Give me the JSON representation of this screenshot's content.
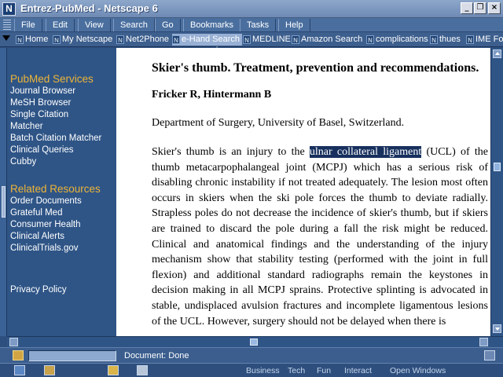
{
  "window": {
    "title": "Entrez-PubMed - Netscape 6",
    "logo_letter": "N",
    "minimize": "_",
    "restore": "❐",
    "close": "×"
  },
  "menu": [
    "File",
    "Edit",
    "View",
    "Search",
    "Go",
    "Bookmarks",
    "Tasks",
    "Help"
  ],
  "toolbar": {
    "items": [
      {
        "label": "Home"
      },
      {
        "label": "My Netscape"
      },
      {
        "label": "Net2Phone"
      },
      {
        "label": "e-Hand Search"
      },
      {
        "label": "MEDLINE"
      },
      {
        "label": "Amazon Search"
      },
      {
        "label": "complications"
      },
      {
        "label": "thues"
      },
      {
        "label": "IME Fo"
      }
    ]
  },
  "sidebar": {
    "services_heading": "PubMed Services",
    "services": [
      "Journal Browser",
      "MeSH Browser",
      "Single Citation",
      "Matcher",
      "Batch Citation Matcher",
      "Clinical Queries",
      "Cubby"
    ],
    "resources_heading": "Related Resources",
    "resources": [
      "Order Documents",
      "Grateful Med",
      "Consumer Health",
      "Clinical Alerts",
      "ClinicalTrials.gov"
    ],
    "privacy": "Privacy Policy"
  },
  "article": {
    "title": "Skier's thumb. Treatment, prevention and recommendations.",
    "authors": "Fricker R, Hintermann B",
    "affiliation": "Department of Surgery, University of Basel, Switzerland.",
    "abstract_before": "Skier's thumb is an injury to the ",
    "abstract_highlight": "ulnar collateral ligament",
    "abstract_after": " (UCL) of the thumb metacarpophalangeal joint (MCPJ) which has a serious risk of disabling chronic instability if not treated adequately. The lesion most often occurs in skiers when the ski pole forces the thumb to deviate radially. Strapless poles do not decrease the incidence of skier's thumb, but if skiers are trained to discard the pole during a fall the risk might be reduced. Clinical and anatomical findings and the understanding of the injury mechanism show that stability testing (performed with the joint in full flexion) and additional standard radiographs remain the keystones in decision making in all MCPJ sprains. Protective splinting is advocated in stable, undisplaced avulsion fractures and incomplete ligamentous lesions of the UCL. However, surgery should not be delayed when there is"
  },
  "status": {
    "text": "Document: Done"
  },
  "taskbar": {
    "links": [
      "Business",
      "Tech",
      "Fun",
      "Interact",
      "Open Windows"
    ]
  }
}
